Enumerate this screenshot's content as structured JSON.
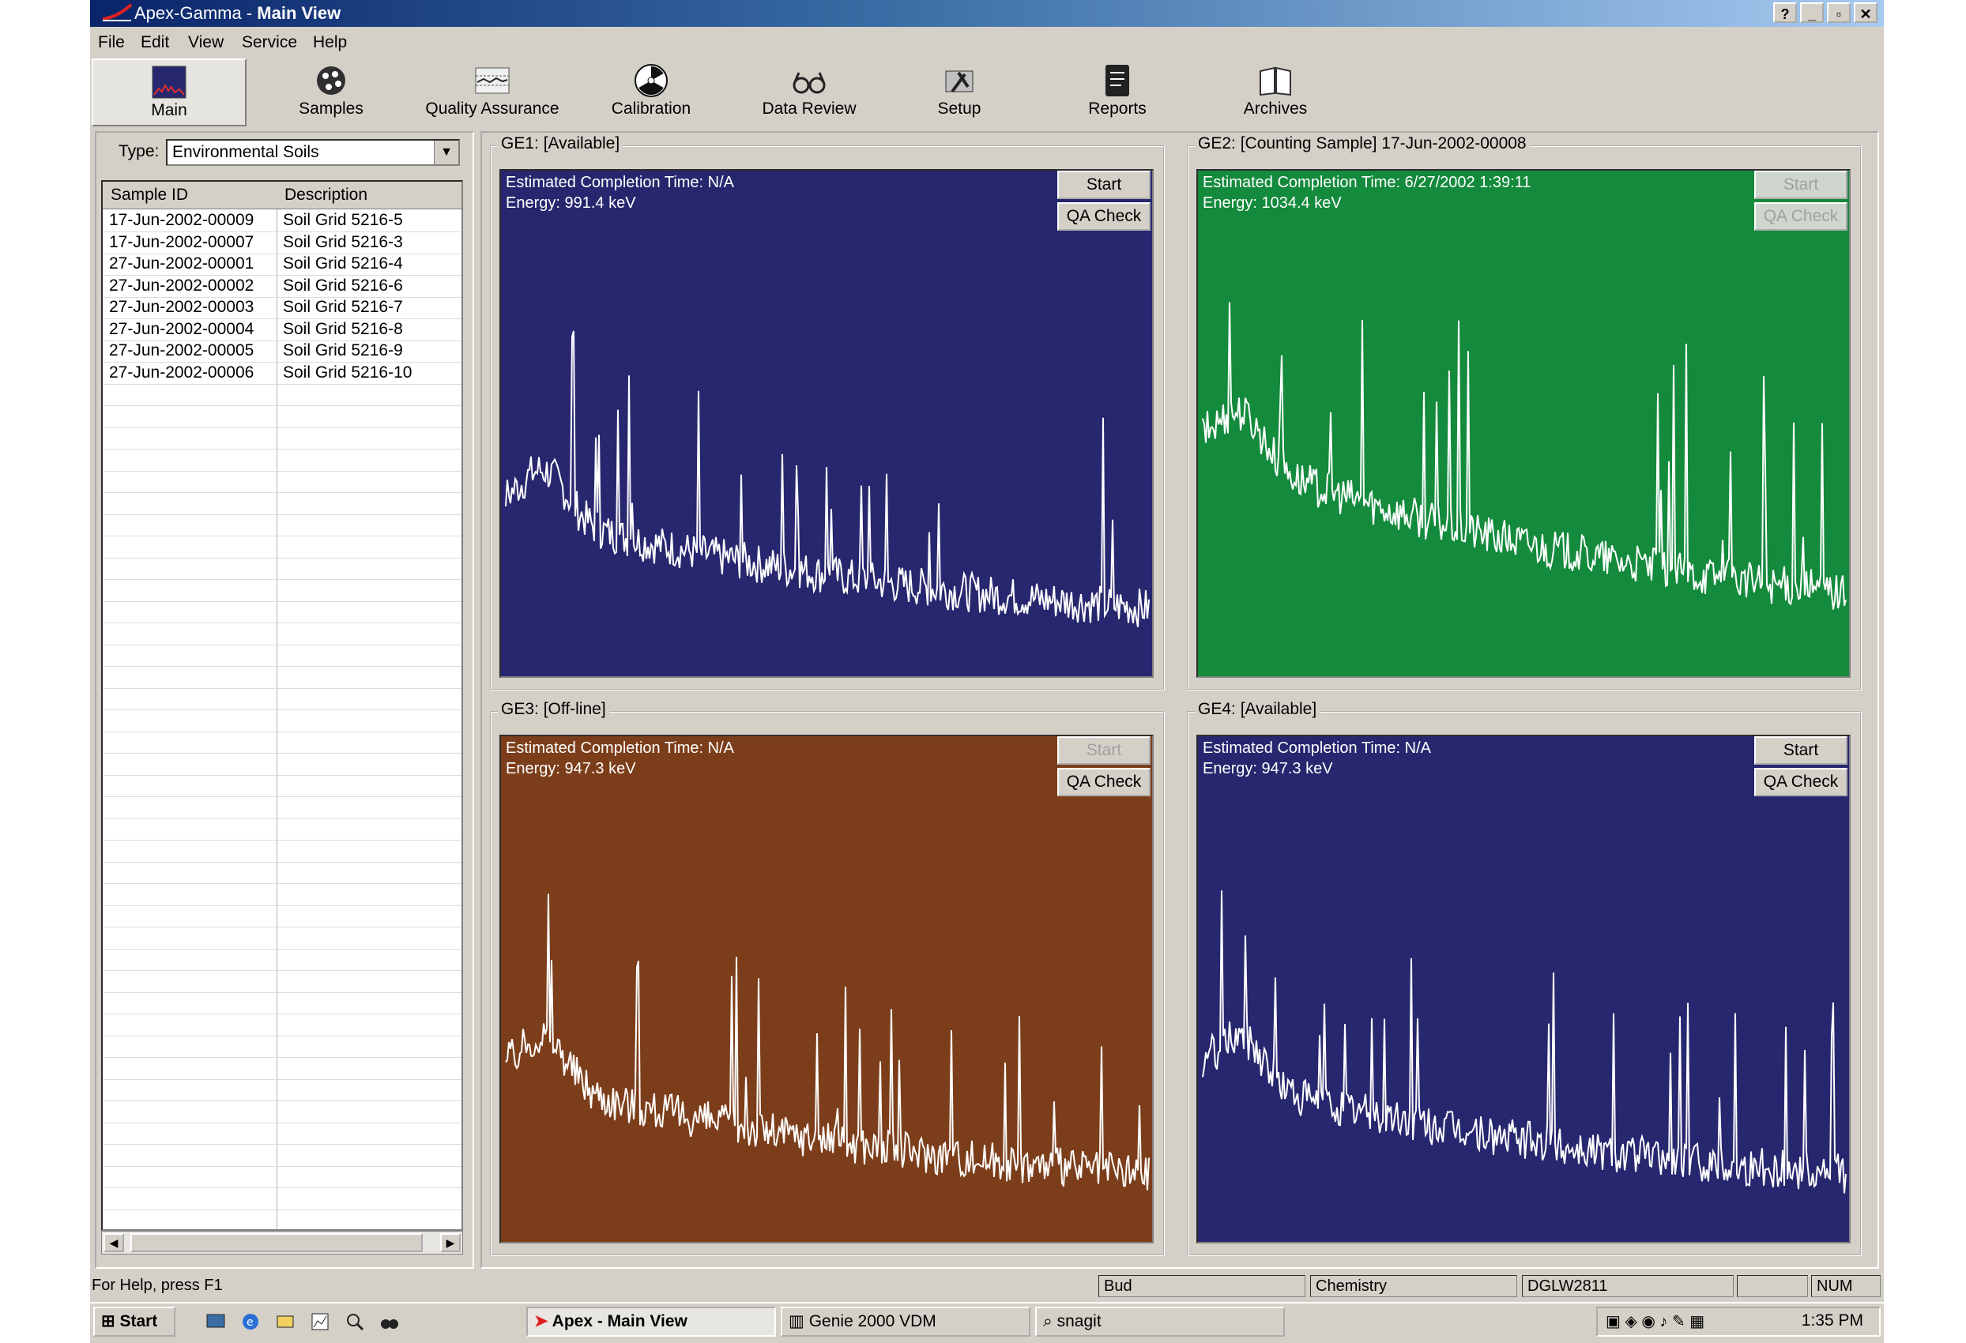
{
  "window": {
    "app_name": "Apex-Gamma",
    "separator": " - ",
    "view_name": "Main View",
    "buttons": [
      "?",
      "_",
      "▫",
      "✕"
    ]
  },
  "menu": [
    "File",
    "Edit",
    "View",
    "Service",
    "Help"
  ],
  "toolbar": [
    {
      "label": "Main",
      "icon": "spectrum-icon",
      "active": true
    },
    {
      "label": "Samples",
      "icon": "samples-icon"
    },
    {
      "label": "Quality Assurance",
      "icon": "qa-chart-icon"
    },
    {
      "label": "Calibration",
      "icon": "radiation-icon"
    },
    {
      "label": "Data Review",
      "icon": "glasses-icon"
    },
    {
      "label": "Setup",
      "icon": "tools-icon"
    },
    {
      "label": "Reports",
      "icon": "report-icon"
    },
    {
      "label": "Archives",
      "icon": "book-icon"
    }
  ],
  "samples_panel": {
    "type_label": "Type:",
    "type_value": "Environmental Soils",
    "columns": [
      "Sample ID",
      "Description"
    ],
    "rows": [
      [
        "17-Jun-2002-00009",
        "Soil Grid 5216-5"
      ],
      [
        "17-Jun-2002-00007",
        "Soil Grid 5216-3"
      ],
      [
        "27-Jun-2002-00001",
        "Soil Grid 5216-4"
      ],
      [
        "27-Jun-2002-00002",
        "Soil Grid 5216-6"
      ],
      [
        "27-Jun-2002-00003",
        "Soil Grid 5216-7"
      ],
      [
        "27-Jun-2002-00004",
        "Soil Grid 5216-8"
      ],
      [
        "27-Jun-2002-00005",
        "Soil Grid 5216-9"
      ],
      [
        "27-Jun-2002-00006",
        "Soil Grid 5216-10"
      ]
    ]
  },
  "detectors": [
    {
      "title": "GE1: [Available]",
      "completion": "Estimated Completion Time: N/A",
      "energy": "Energy:   991.4 keV",
      "bg": "#27276f",
      "start": "Start",
      "qa": "QA Check",
      "enabled": true
    },
    {
      "title": "GE2: [Counting Sample] 17-Jun-2002-00008",
      "completion": "Estimated Completion Time: 6/27/2002 1:39:11",
      "energy": "Energy:   1034.4 keV",
      "bg": "#148a3c",
      "start": "Start",
      "qa": "QA Check",
      "enabled": false
    },
    {
      "title": "GE3: [Off-line]",
      "completion": "Estimated Completion Time: N/A",
      "energy": "Energy:   947.3 keV",
      "bg": "#7c3e1a",
      "start": "Start",
      "qa": "QA Check",
      "enabled": false
    },
    {
      "title": "GE4: [Available]",
      "completion": "Estimated Completion Time: N/A",
      "energy": "Energy:   947.3 keV",
      "bg": "#27276f",
      "start": "Start",
      "qa": "QA Check",
      "enabled": true
    }
  ],
  "statusbar": {
    "help": "For Help, press F1",
    "user": "Bud",
    "dept": "Chemistry",
    "machine": "DGLW2811",
    "num": "NUM"
  },
  "taskbar": {
    "start": "Start",
    "tasks": [
      "Apex - Main View",
      "Genie 2000 VDM",
      "snagit"
    ],
    "clock": "1:35 PM"
  }
}
